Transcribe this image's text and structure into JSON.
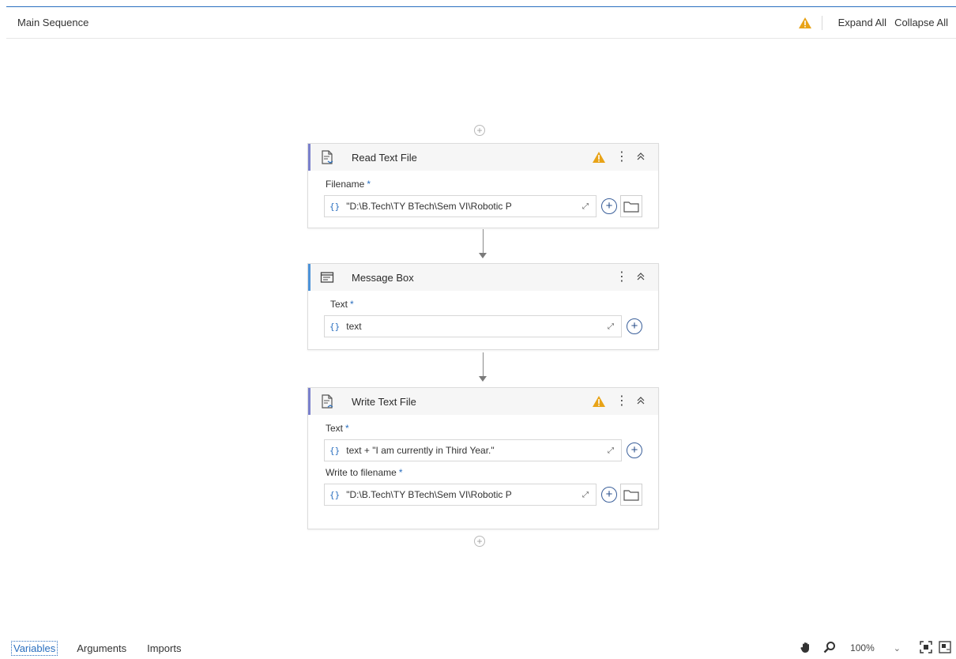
{
  "header": {
    "title": "Main Sequence",
    "expand_all": "Expand All",
    "collapse_all": "Collapse All",
    "warning_icon": "warning-icon"
  },
  "activities": [
    {
      "name": "Read Text File",
      "icon": "read-text-file-icon",
      "warning": true,
      "properties": [
        {
          "label": "Filename",
          "required": "*",
          "value": "\"D:\\B.Tech\\TY BTech\\Sem VI\\Robotic P",
          "braces": "{}",
          "has_folder": true
        }
      ]
    },
    {
      "name": "Message Box",
      "icon": "message-box-icon",
      "warning": false,
      "properties": [
        {
          "label": "Text",
          "required": "*",
          "value": "text",
          "braces": "{}",
          "has_folder": false
        }
      ]
    },
    {
      "name": "Write Text File",
      "icon": "write-text-file-icon",
      "warning": true,
      "properties": [
        {
          "label": "Text",
          "required": "*",
          "value": "text + \"I am currently in Third Year.\"",
          "braces": "{}",
          "has_folder": false
        },
        {
          "label": "Write to filename",
          "required": "*",
          "value": "\"D:\\B.Tech\\TY BTech\\Sem VI\\Robotic P",
          "braces": "{}",
          "has_folder": true
        }
      ]
    }
  ],
  "footer": {
    "tabs": [
      "Variables",
      "Arguments",
      "Imports"
    ],
    "zoom": "100%"
  },
  "colors": {
    "accent": "#2a6fbf",
    "warning": "#e8a317",
    "read_bar": "#7a80cc",
    "msg_bar": "#4d93d9"
  }
}
